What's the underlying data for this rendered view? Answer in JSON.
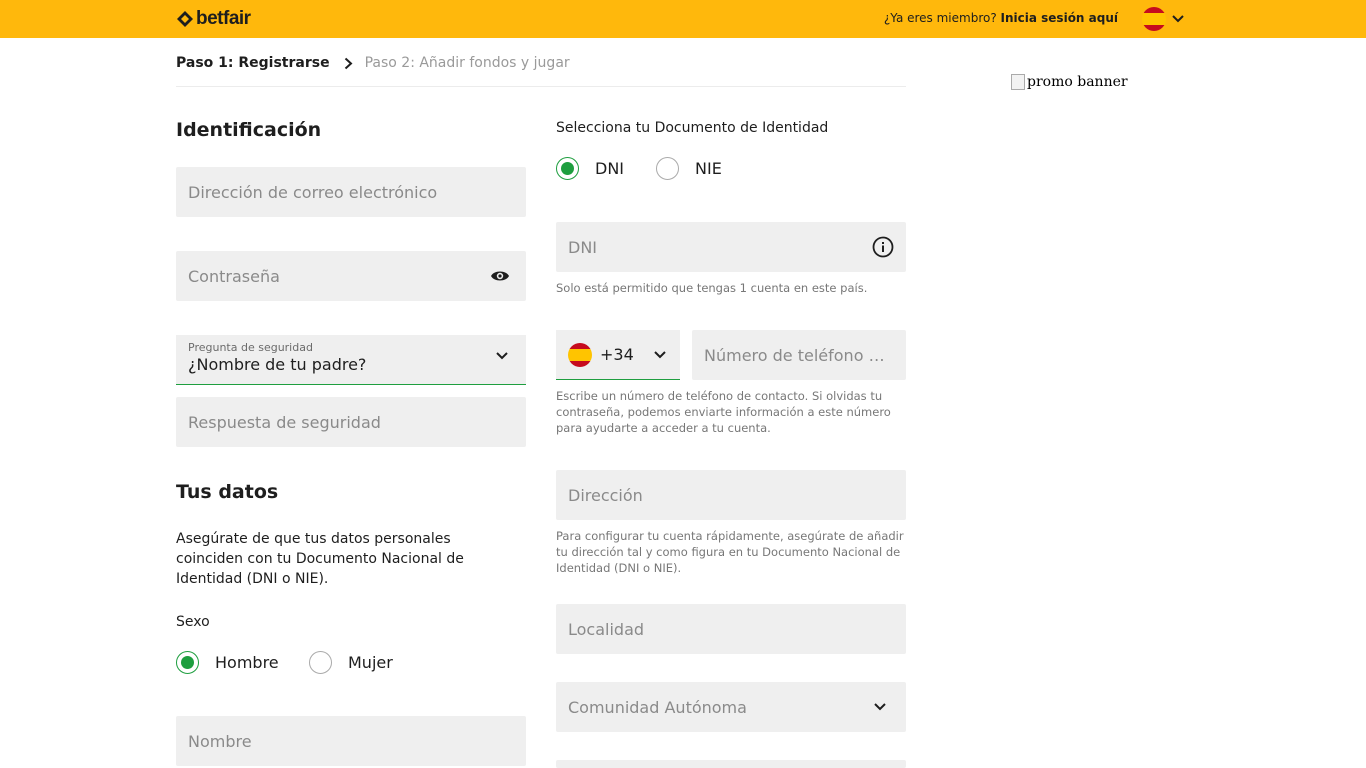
{
  "header": {
    "brand": "betfair",
    "member_prompt": "¿Ya eres miembro?",
    "login_link": "Inicia sesión aquí",
    "language": "Spain flag",
    "accent_color": "#ffb80c"
  },
  "steps": {
    "step1": "Paso 1: Registrarse",
    "step2": "Paso 2: Añadir fondos y jugar"
  },
  "promo": {
    "alt": "promo banner"
  },
  "identification": {
    "title": "Identificación",
    "email_placeholder": "Dirección de correo electrónico",
    "password_placeholder": "Contraseña",
    "security_question_label": "Pregunta de seguridad",
    "security_question_value": "¿Nombre de tu padre?",
    "security_answer_placeholder": "Respuesta de seguridad"
  },
  "personal": {
    "title": "Tus datos",
    "notice": "Asegúrate de que tus datos personales coinciden con tu Documento Nacional de Identidad (DNI o NIE).",
    "sex_label": "Sexo",
    "sex_options": [
      {
        "label": "Hombre",
        "selected": true
      },
      {
        "label": "Mujer",
        "selected": false
      }
    ],
    "name_placeholder": "Nombre"
  },
  "document": {
    "label": "Selecciona tu Documento de Identidad",
    "options": [
      {
        "label": "DNI",
        "selected": true
      },
      {
        "label": "NIE",
        "selected": false
      }
    ],
    "dni_placeholder": "DNI",
    "dni_help": "Solo está permitido que tengas 1 cuenta en este país."
  },
  "phone": {
    "prefix": "+34",
    "placeholder": "Número de teléfono m...",
    "help": "Escribe un número de teléfono de contacto. Si olvidas tu contraseña, podemos enviarte información a este número para ayudarte a acceder a tu cuenta."
  },
  "address": {
    "placeholder": "Dirección",
    "help": "Para configurar tu cuenta rápidamente, asegúrate de añadir tu dirección tal y como figura en tu Documento Nacional de Identidad (DNI o NIE).",
    "city_placeholder": "Localidad",
    "region_placeholder": "Comunidad Autónoma"
  },
  "colors": {
    "selected_green": "#1e9e3f",
    "field_bg": "#efefef"
  }
}
